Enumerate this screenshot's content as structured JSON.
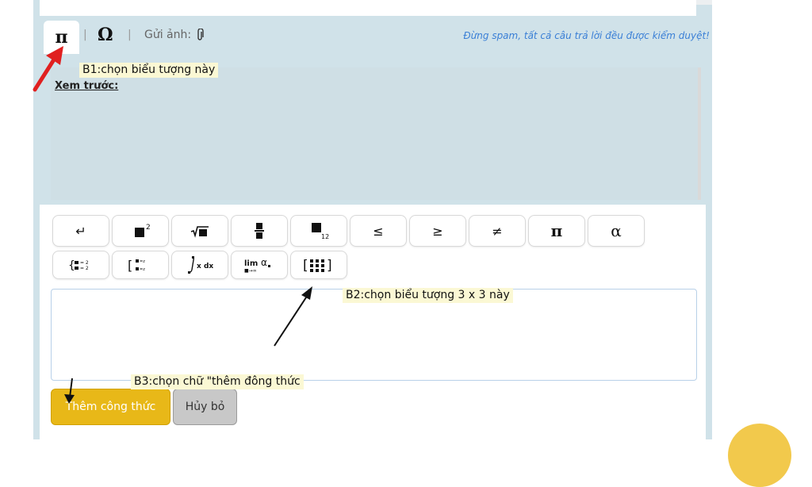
{
  "toolbar": {
    "pi_tab": "π",
    "separator": "|",
    "omega_tab": "Ω",
    "upload_label": "Gửi ảnh:",
    "upload_icon": "paperclip-icon",
    "notice": "Đừng spam, tất cả câu trả lời đều được kiểm duyệt!"
  },
  "preview": {
    "label": "Xem trước:"
  },
  "keys_row1": [
    "↵",
    "x²",
    "√x",
    "a/b",
    "x₁₂",
    "≤",
    "≥",
    "≠",
    "π",
    "α"
  ],
  "keys_row2": [
    "system",
    "matrix-2",
    "∫ x dx",
    "lim α",
    "[⁝⁝⁝]"
  ],
  "buttons": {
    "add": "Thêm công thức",
    "cancel": "Hủy bỏ"
  },
  "annotations": {
    "b1": "B1:chọn biểu tượng này",
    "b2": "B2:chọn biểu tượng 3 x 3 này",
    "b3": "B3:chọn chữ \"thêm đông thức"
  },
  "colors": {
    "panel": "#d0e2e9",
    "notice": "#3a7fd6",
    "add_button": "#e8b818",
    "cancel_button": "#c8c8c8",
    "arrow_red": "#e02020"
  }
}
